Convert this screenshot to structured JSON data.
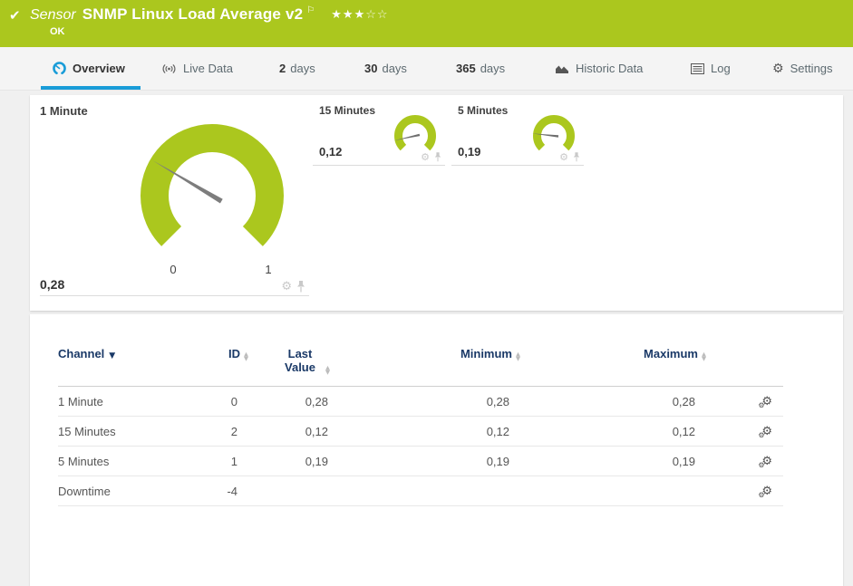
{
  "colors": {
    "brand_green": "#abc71e",
    "accent_blue": "#199cd8",
    "header_navy": "#1a3967",
    "needle_gray": "#7d7d7d"
  },
  "icons": {
    "check": "✔",
    "flag": "⚐",
    "gear": "⚙",
    "sort_asc": "▲",
    "sort_desc": "▼"
  },
  "header": {
    "type_label": "Sensor",
    "title": "SNMP Linux Load Average v2",
    "stars_filled": "★★★",
    "stars_empty": "☆☆",
    "status_text": "OK"
  },
  "tabs": {
    "overview": {
      "label": "Overview"
    },
    "live_data": {
      "label": "Live Data"
    },
    "days2": {
      "num": "2",
      "unit": "days"
    },
    "days30": {
      "num": "30",
      "unit": "days"
    },
    "days365": {
      "num": "365",
      "unit": "days"
    },
    "historic": {
      "label": "Historic Data"
    },
    "log": {
      "label": "Log"
    },
    "settings": {
      "label": "Settings"
    }
  },
  "gauges": {
    "primary": {
      "title": "1 Minute",
      "value": "0,28",
      "value_num": 0.28,
      "scale_min": "0",
      "scale_max": "1"
    },
    "gauge_15min": {
      "title": "15 Minutes",
      "value": "0,12",
      "value_num": 0.12
    },
    "gauge_5min": {
      "title": "5 Minutes",
      "value": "0,19",
      "value_num": 0.19
    }
  },
  "channel_table": {
    "headers": {
      "channel": "Channel",
      "id": "ID",
      "last_value": "Last Value",
      "minimum": "Minimum",
      "maximum": "Maximum"
    },
    "rows": [
      {
        "channel": "1 Minute",
        "id": "0",
        "last": "0,28",
        "min": "0,28",
        "max": "0,28"
      },
      {
        "channel": "15 Minutes",
        "id": "2",
        "last": "0,12",
        "min": "0,12",
        "max": "0,12"
      },
      {
        "channel": "5 Minutes",
        "id": "1",
        "last": "0,19",
        "min": "0,19",
        "max": "0,19"
      },
      {
        "channel": "Downtime",
        "id": "-4",
        "last": "",
        "min": "",
        "max": ""
      }
    ]
  }
}
